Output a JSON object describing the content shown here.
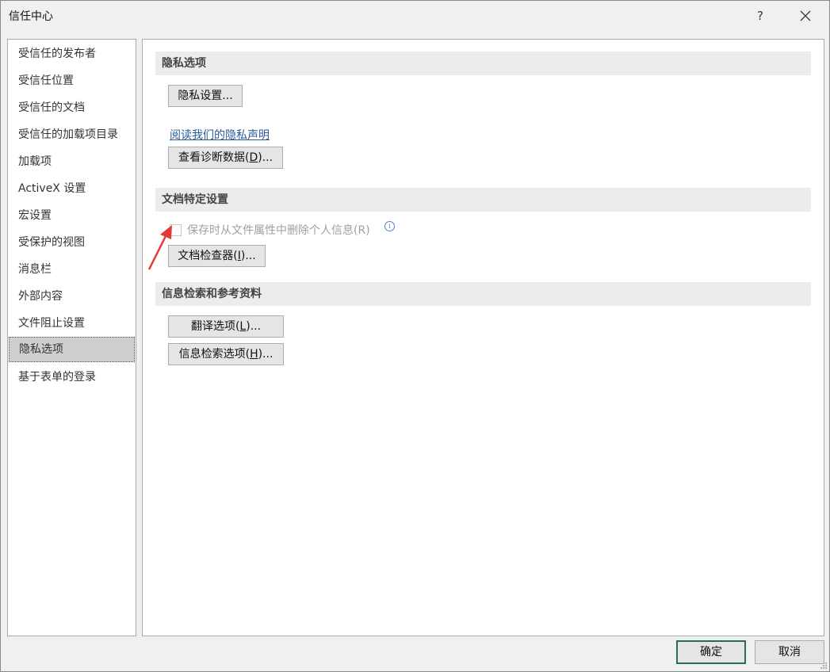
{
  "window": {
    "title": "信任中心",
    "help_label": "?"
  },
  "sidebar": {
    "items": [
      {
        "label": "受信任的发布者"
      },
      {
        "label": "受信任位置"
      },
      {
        "label": "受信任的文档"
      },
      {
        "label": "受信任的加载项目录"
      },
      {
        "label": "加载项"
      },
      {
        "label": "ActiveX 设置"
      },
      {
        "label": "宏设置"
      },
      {
        "label": "受保护的视图"
      },
      {
        "label": "消息栏"
      },
      {
        "label": "外部内容"
      },
      {
        "label": "文件阻止设置"
      },
      {
        "label": "隐私选项",
        "selected": true
      },
      {
        "label": "基于表单的登录"
      }
    ]
  },
  "privacy": {
    "header": "隐私选项",
    "settings_button": "隐私设置...",
    "statement_link": "阅读我们的隐私声明",
    "diag_button_pre": "查看诊断数据(",
    "diag_button_key": "D",
    "diag_button_post": ")..."
  },
  "document": {
    "header": "文档特定设置",
    "checkbox_label": "保存时从文件属性中删除个人信息(R)",
    "checkbox_checked": false,
    "inspector_pre": "文档检查器(",
    "inspector_key": "I",
    "inspector_post": ")..."
  },
  "research": {
    "header": "信息检索和参考资料",
    "translate_pre": "翻译选项(",
    "translate_key": "L",
    "translate_post": ")...",
    "research_pre": "信息检索选项(",
    "research_key": "H",
    "research_post": ")..."
  },
  "footer": {
    "ok_label": "确定",
    "cancel_label": "取消"
  },
  "colors": {
    "annotation_arrow": "#e53935",
    "link": "#2a5b9b",
    "default_button_border": "#2b6e4c"
  }
}
